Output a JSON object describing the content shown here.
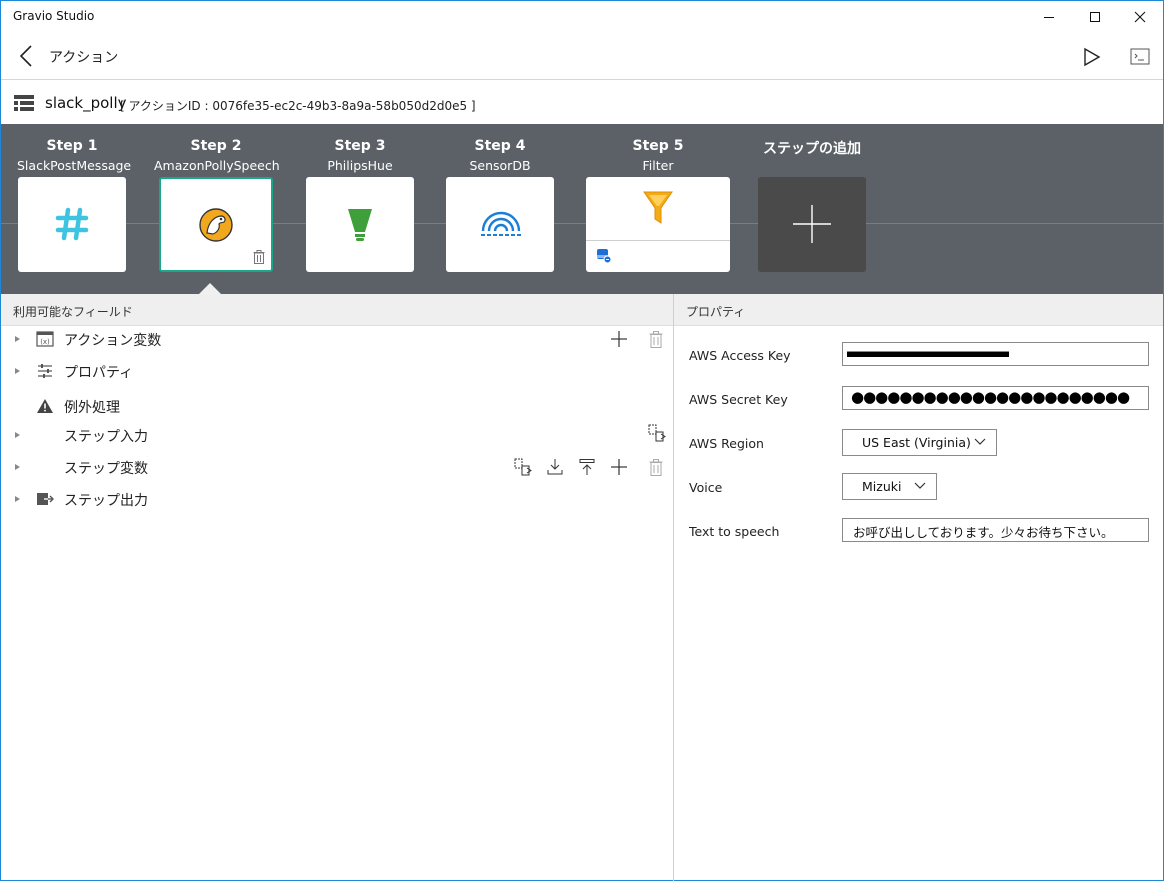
{
  "window": {
    "title": "Gravio Studio"
  },
  "nav": {
    "title": "アクション"
  },
  "action": {
    "name": "slack_polly",
    "id_text": "[ アクションID : 0076fe35-ec2c-49b3-8a9a-58b050d2d0e5 ]"
  },
  "steps": [
    {
      "num": "Step 1",
      "type": "SlackPostMessage",
      "icon": "slack-hash-icon"
    },
    {
      "num": "Step 2",
      "type": "AmazonPollySpeech",
      "icon": "polly-parrot-icon",
      "selected": true
    },
    {
      "num": "Step 3",
      "type": "PhilipsHue",
      "icon": "hue-bulb-icon"
    },
    {
      "num": "Step 4",
      "type": "SensorDB",
      "icon": "sensor-wave-icon"
    },
    {
      "num": "Step 5",
      "type": "Filter",
      "icon": "filter-funnel-icon"
    }
  ],
  "add_step": {
    "label": "ステップの追加"
  },
  "left_panel": {
    "header": "利用可能なフィールド",
    "rows": [
      {
        "label": "アクション変数",
        "icon": "variable-icon"
      },
      {
        "label": "プロパティ",
        "icon": "sliders-icon"
      },
      {
        "label": "例外処理",
        "icon": "warning-icon"
      },
      {
        "label": "ステップ入力",
        "icon": ""
      },
      {
        "label": "ステップ変数",
        "icon": ""
      },
      {
        "label": "ステップ出力",
        "icon": "output-icon"
      }
    ]
  },
  "right_panel": {
    "header": "プロパティ",
    "access_key_label": "AWS Access Key",
    "secret_key_label": "AWS Secret Key",
    "secret_key_value": "●●●●●●●●●●●●●●●●●●●●●●●",
    "region_label": "AWS Region",
    "region_value": "US East (Virginia)",
    "voice_label": "Voice",
    "voice_value": "Mizuki",
    "tts_label": "Text to speech",
    "tts_value": "お呼び出ししております。少々お待ち下さい。"
  },
  "colors": {
    "strip_bg": "#5b6166",
    "selected_border": "#1aa88c",
    "window_border": "#1e88d8"
  }
}
